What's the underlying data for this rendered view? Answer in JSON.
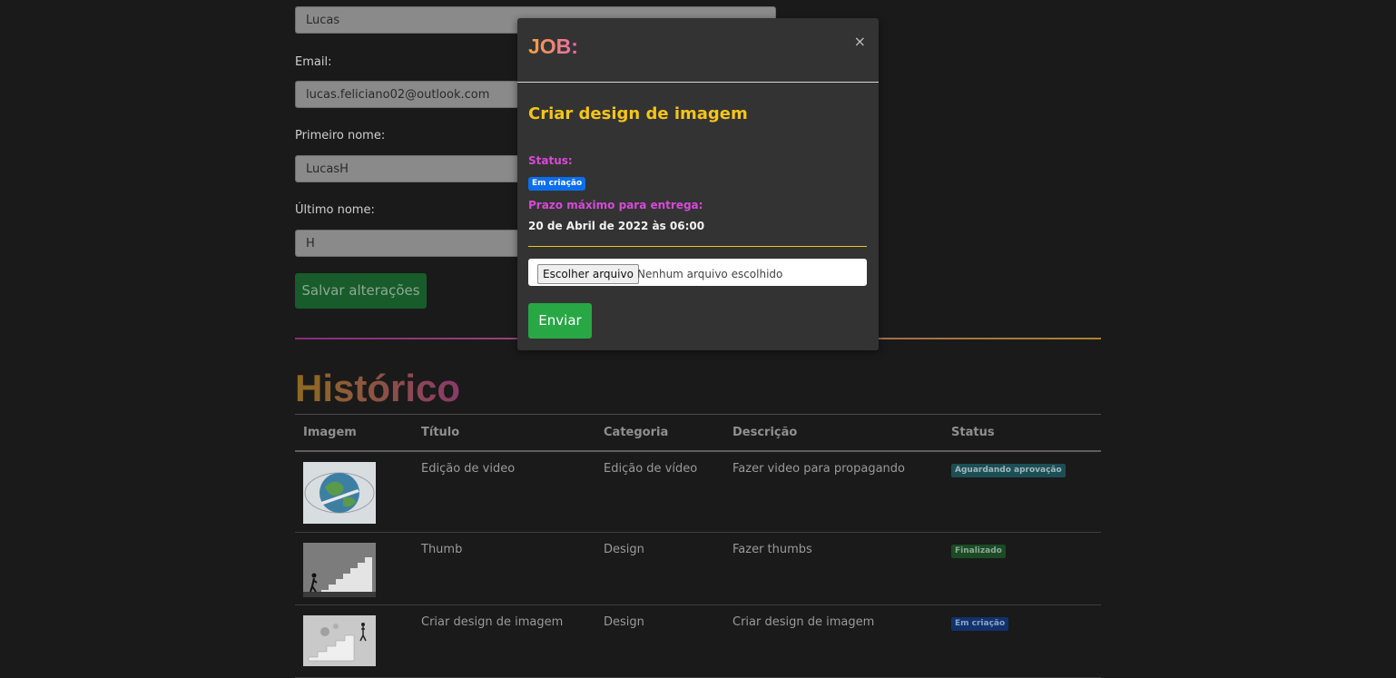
{
  "profile_form": {
    "username_value": "Lucas",
    "email_label": "Email:",
    "email_value": "lucas.feliciano02@outlook.com",
    "first_name_label": "Primeiro nome:",
    "first_name_value": "LucasH",
    "last_name_label": "Último nome:",
    "last_name_value": "H",
    "save_label": "Salvar alterações"
  },
  "history": {
    "title": "Histórico",
    "columns": [
      "Imagem",
      "Título",
      "Categoria",
      "Descrição",
      "Status"
    ],
    "rows": [
      {
        "title": "Edição de video",
        "category": "Edição de vídeo",
        "description": "Fazer video para propagando",
        "status": "Aguardando aprovação"
      },
      {
        "title": "Thumb",
        "category": "Design",
        "description": "Fazer thumbs",
        "status": "Finalizado"
      },
      {
        "title": "Criar design de imagem",
        "category": "Design",
        "description": "Criar design de imagem",
        "status": "Em criação"
      }
    ]
  },
  "modal": {
    "title": "JOB:",
    "close_symbol": "×",
    "job_name": "Criar design de imagem",
    "status_label": "Status:",
    "status_value": "Em criação",
    "deadline_label": "Prazo máximo para entrega:",
    "deadline_value": "20 de Abril de 2022 às 06:00",
    "file_button_label": "Escolher arquivo",
    "file_status": "Nenhum arquivo escolhido",
    "submit_label": "Enviar"
  },
  "colors": {
    "background": "#1a1a1a",
    "modal_background": "#333333",
    "job_name": "#f5c518",
    "label_pink": "#d64ad8",
    "badge_blue": "#0a6ef0",
    "submit_green": "#28a745"
  },
  "icons": [
    "close-icon"
  ]
}
